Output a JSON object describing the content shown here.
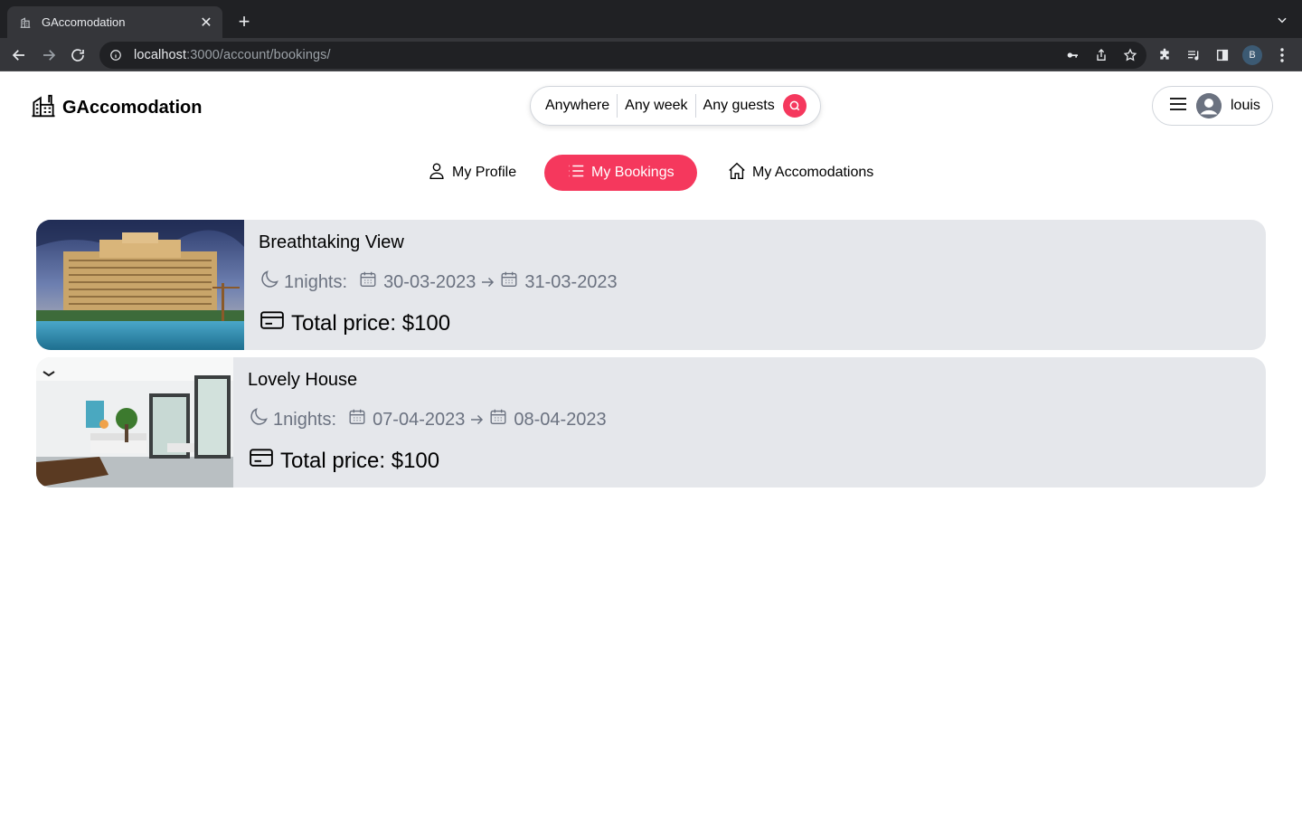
{
  "browser": {
    "tab_title": "GAccomodation",
    "url_host": "localhost",
    "url_path": ":3000/account/bookings/",
    "profile_initial": "B"
  },
  "header": {
    "logo_text": "GAccomodation",
    "search": {
      "where": "Anywhere",
      "when": "Any week",
      "who": "Any guests"
    },
    "user_name": "louis"
  },
  "subnav": [
    {
      "label": "My Profile",
      "icon": "user-icon",
      "active": false
    },
    {
      "label": "My Bookings",
      "icon": "list-icon",
      "active": true
    },
    {
      "label": "My Accomodations",
      "icon": "home-icon",
      "active": false
    }
  ],
  "bookings": [
    {
      "title": "Breathtaking View",
      "nights": "1nights:",
      "check_in": "30-03-2023",
      "check_out": "31-03-2023",
      "price": "Total price: $100"
    },
    {
      "title": "Lovely House",
      "nights": "1nights:",
      "check_in": "07-04-2023",
      "check_out": "08-04-2023",
      "price": "Total price: $100"
    }
  ],
  "colors": {
    "accent": "#F5385D",
    "card_bg": "#e5e7eb",
    "muted_text": "#6b7280"
  }
}
